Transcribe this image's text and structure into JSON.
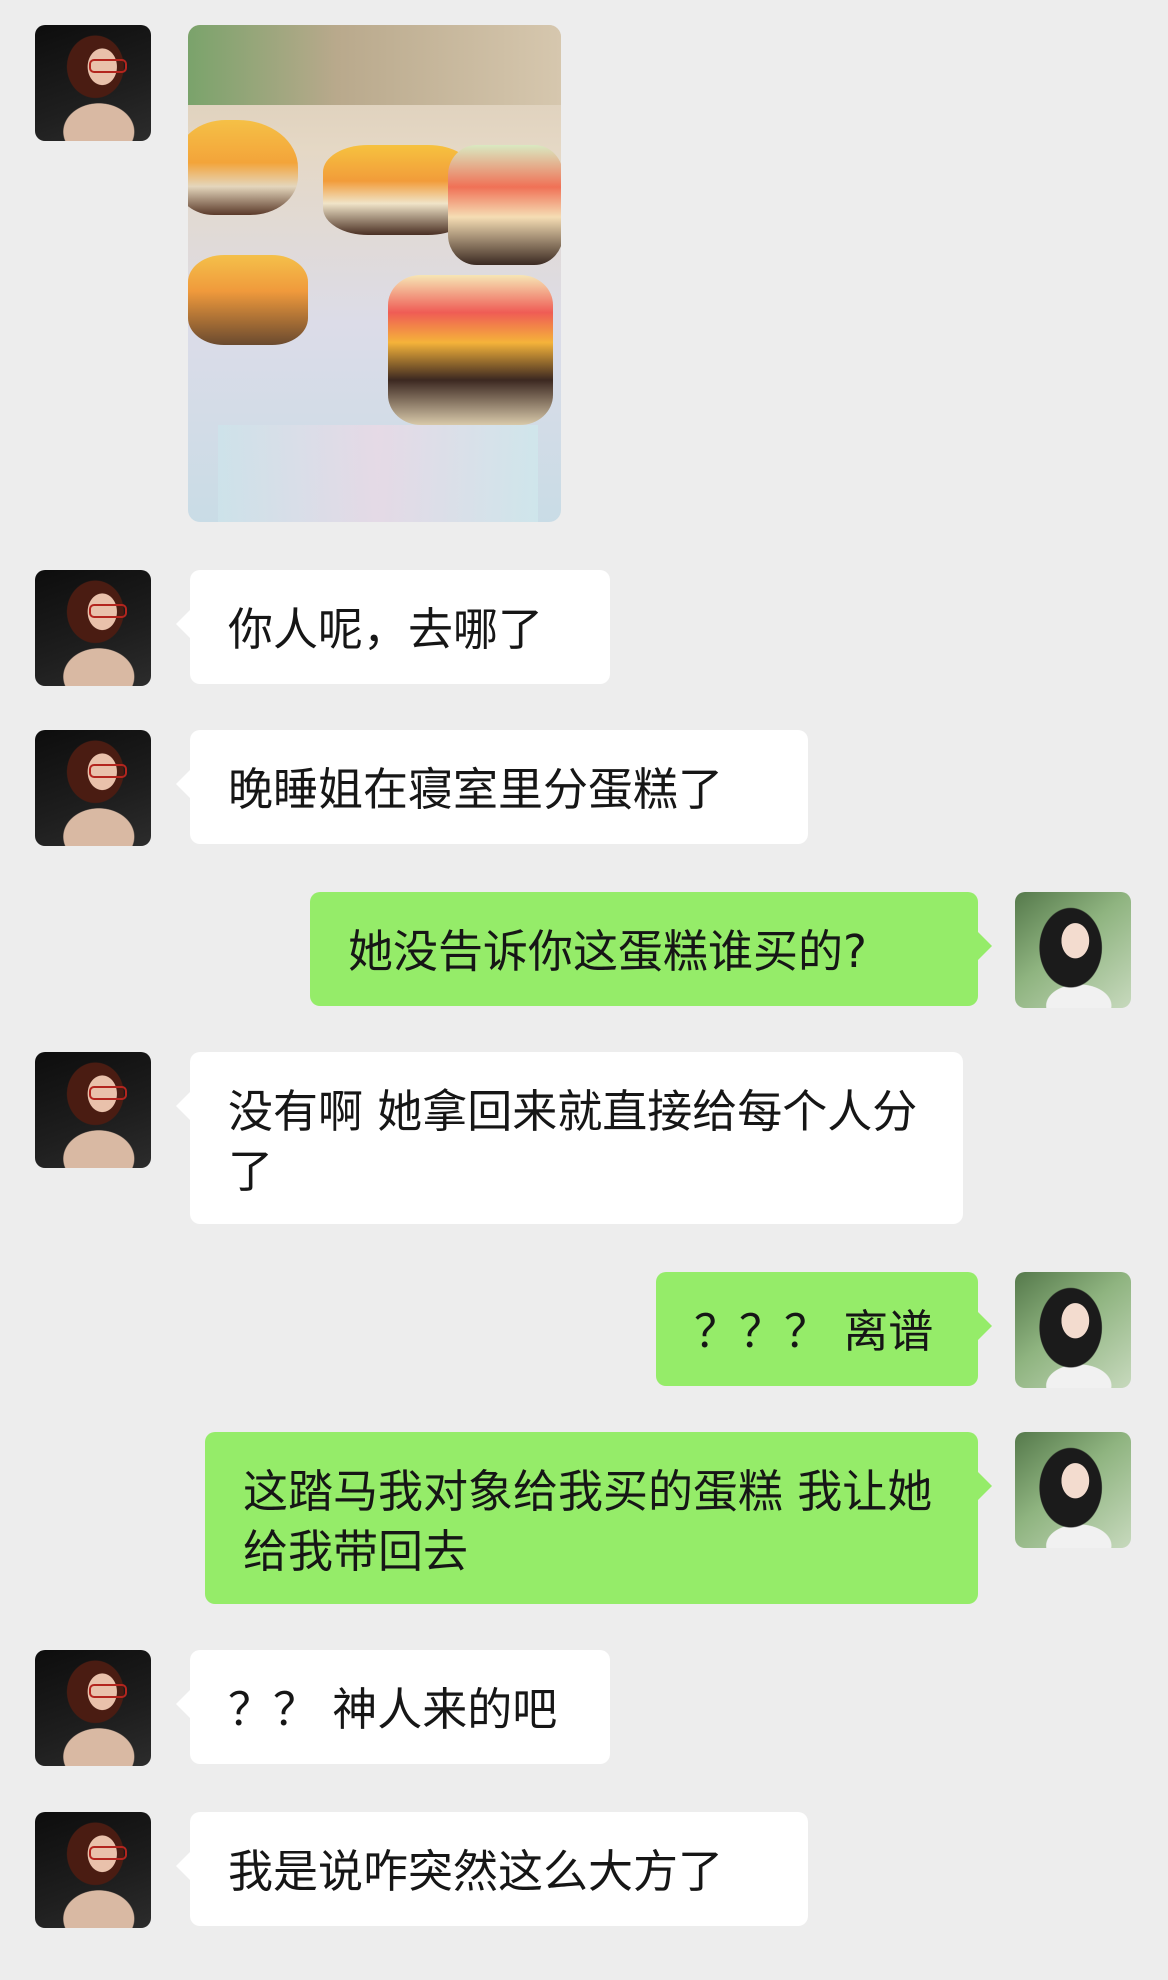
{
  "messages": [
    {
      "side": "left",
      "type": "image",
      "image_label": "cake-slices-photo"
    },
    {
      "side": "left",
      "type": "text",
      "text": "你人呢，去哪了"
    },
    {
      "side": "left",
      "type": "text",
      "text": "晚睡姐在寝室里分蛋糕了"
    },
    {
      "side": "right",
      "type": "text",
      "text": "她没告诉你这蛋糕谁买的?"
    },
    {
      "side": "left",
      "type": "text",
      "text": "没有啊 她拿回来就直接给每个人分了"
    },
    {
      "side": "right",
      "type": "text",
      "text": "？？？ 离谱"
    },
    {
      "side": "right",
      "type": "text",
      "text": "这踏马我对象给我买的蛋糕 我让她给我带回去"
    },
    {
      "side": "left",
      "type": "text",
      "text": "？？ 神人来的吧"
    },
    {
      "side": "left",
      "type": "text",
      "text": "我是说咋突然这么大方了"
    }
  ],
  "colors": {
    "background": "#ededed",
    "incoming_bubble": "#ffffff",
    "outgoing_bubble": "#95ec69"
  },
  "icons": {
    "incoming_avatar": "avatar-woman-with-red-glasses",
    "outgoing_avatar": "avatar-woman-long-dark-hair"
  }
}
